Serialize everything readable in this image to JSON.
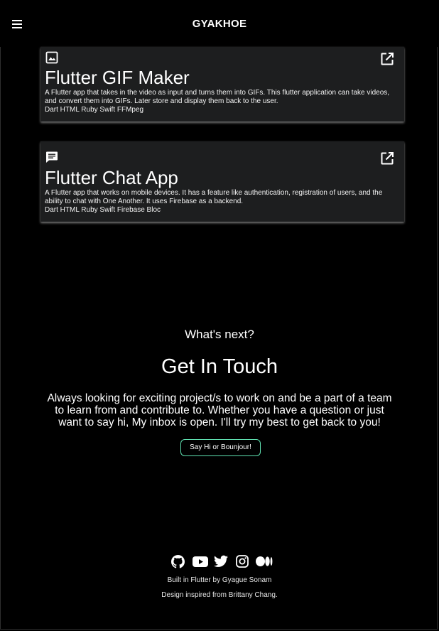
{
  "app": {
    "title": "GYAKHOE"
  },
  "projects": [
    {
      "icon": "image-icon",
      "title": "Flutter GIF Maker",
      "description": "A Flutter app that takes in the video as input and turns them into GIFs. This flutter application can take videos, and convert them into GIFs. Later store and display them back to the user.",
      "tech": "Dart HTML Ruby Swift FFMpeg"
    },
    {
      "icon": "chat-icon",
      "title": "Flutter Chat App",
      "description": "A Flutter app that works on mobile devices. It has a feature like authentication, registration of users, and the ability to chat with One Another. It uses Firebase as a backend.",
      "tech": "Dart HTML Ruby Swift Firebase Bloc"
    }
  ],
  "contact": {
    "kicker": "What's next?",
    "heading": "Get In Touch",
    "body": "Always looking for exciting project/s to work on and be a part of a team to learn from and contribute to. Whether you have a question or just want to say hi, My inbox is open. I'll try my best to get back to you!",
    "button_label": "Say Hi or Bounjour!",
    "accent_color": "#5fe0b0"
  },
  "footer": {
    "social_icons": [
      "github-icon",
      "youtube-icon",
      "twitter-icon",
      "instagram-icon",
      "medium-icon"
    ],
    "built_by": "Built in Flutter by Gyague Sonam",
    "inspired_by": "Design inspired from Brittany Chang."
  }
}
